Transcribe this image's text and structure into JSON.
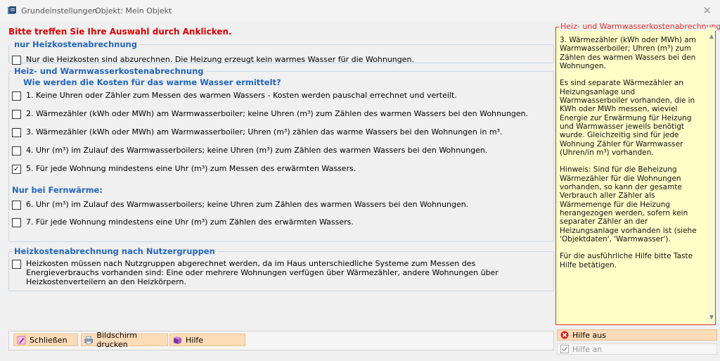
{
  "window": {
    "title": "Grundeinstellungen",
    "object_label": "Objekt: Mein Objekt",
    "close_symbol": "✕"
  },
  "instruction": "Bitte treffen Sie Ihre Auswahl durch Anklicken.",
  "group_heating_only": {
    "legend": "nur Heizkostenabrechnung",
    "option": {
      "label": "Nur die Heizkosten sind abzurechnen. Die Heizung erzeugt kein warmes Wasser für die Wohnungen.",
      "checked": false
    }
  },
  "group_heating_water": {
    "legend": "Heiz- und Warmwasserkostenabrechnung",
    "question": "Wie werden die Kosten für das warme Wasser ermittelt?",
    "options": [
      {
        "label": "1. Keine Uhren oder Zähler zum Messen des warmen Wassers - Kosten werden pauschal errechnet und verteilt.",
        "checked": false
      },
      {
        "label": "2. Wärmezähler (kWh oder MWh) am Warmwasserboiler; keine Uhren (m³) zum Zählen des warmen Wassers bei den Wohnungen.",
        "checked": false
      },
      {
        "label": "3. Wärmezähler (kWh oder MWh) am Warmwasserboiler; Uhren (m³) zählen das warme Wassers bei den Wohnungen in m³.",
        "checked": false
      },
      {
        "label": "4. Uhr (m³) im Zulauf des Warmwasserboilers; keine Uhren (m³) zum Zählen des warmen Wassers bei den Wohnungen.",
        "checked": false
      },
      {
        "label": "5. Für jede Wohnung mindestens eine Uhr (m³) zum Messen des erwärmten Wassers.",
        "checked": true
      }
    ],
    "district_heating_heading": "Nur bei Fernwärme:",
    "district_options": [
      {
        "label": "6. Uhr (m³) im Zulauf des Warmwasserboilers; keine Uhren zum Zählen des warmen Wassers bei den Wohnungen.",
        "checked": false
      },
      {
        "label": "7. Für jede Wohnung mindestens eine Uhr (m³) zum Zählen des erwärmten Wassers.",
        "checked": false
      }
    ]
  },
  "group_user_groups": {
    "legend": "Heizkostenabrechnung nach Nutzergruppen",
    "option": {
      "label": "Heizkosten müssen nach Nutzgruppen abgerechnet werden, da im Haus unterschiedliche Systeme zum Messen des Energieverbrauchs vorhanden sind: Eine oder mehrere Wohnungen verfügen über Wärmezähler, andere Wohnungen über Heizkostenverteilern an den  Heizkörpern.",
      "checked": false
    }
  },
  "buttons": {
    "close": "Schließen",
    "print": "Bildschirm drucken",
    "help": "Hilfe"
  },
  "help_panel": {
    "title": "Heiz- und Warmwasserkostenabrechnung",
    "text": "3. Wärmezähler (kWh oder MWh) am Warmwasserboiler; Uhren (m³) zum Zählen des warmen Wassers bei den Wohnungen.\n\nEs sind separate Wärmezähler an Heizungsanlage und Warmwasserboiler vorhanden, die in KWh oder MWh messen, wieviel Energie zur Erwärmung für Heizung und Warmwasser jeweils benötigt wurde. Gleichzeitig sind für jede Wohnung Zähler für Warmwasser (Uhren/in m³) vorhanden.\n\nHinweis: Sind für die Beheizung Wärmezähler für die Wohnungen vorhanden, so kann der gesamte Verbrauch aller Zähler als Wärmemenge für die Heizung herangezogen werden, sofern kein separater Zähler an der Heizungsanlage vorhanden ist (siehe 'Objektdaten', 'Warmwasser').\n\nFür die ausführliche Hilfe bitte Taste Hilfe betätigen.",
    "hide_label": "Hilfe aus",
    "show_label": "Hilfe an"
  },
  "colors": {
    "accent": "#2266bb",
    "instruction": "#e00000",
    "help_border": "#e03030",
    "help_bg": "#ffffc8",
    "button_bg": "#ffdcb8"
  }
}
